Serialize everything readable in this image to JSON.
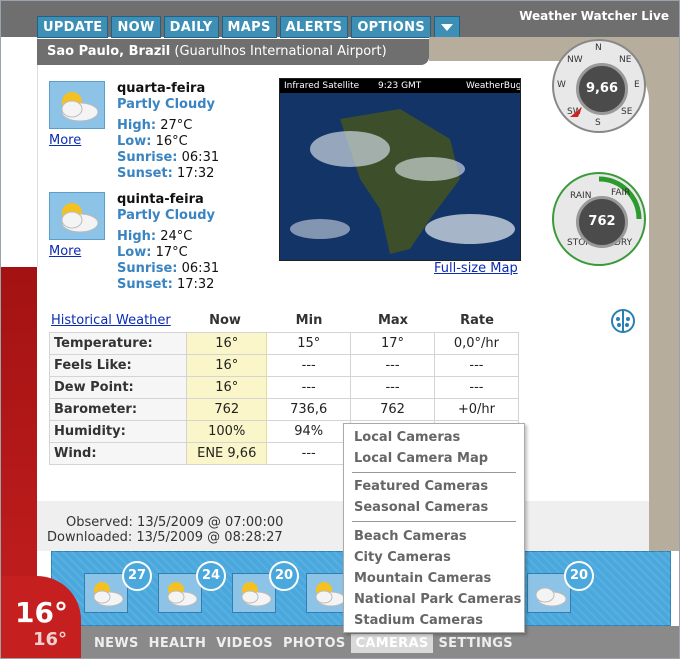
{
  "app": {
    "title": "Weather Watcher Live"
  },
  "menu": [
    "UPDATE",
    "NOW",
    "DAILY",
    "MAPS",
    "ALERTS",
    "OPTIONS"
  ],
  "location": {
    "city": "Sao Paulo, Brazil",
    "station": "(Guarulhos International Airport)"
  },
  "forecast": [
    {
      "day": "quarta-feira",
      "condition": "Partly Cloudy",
      "high_label": "High:",
      "high": "27°C",
      "low_label": "Low:",
      "low": "16°C",
      "sunrise_label": "Sunrise:",
      "sunrise": "06:31",
      "sunset_label": "Sunset:",
      "sunset": "17:32",
      "more": "More"
    },
    {
      "day": "quinta-feira",
      "condition": "Partly Cloudy",
      "high_label": "High:",
      "high": "24°C",
      "low_label": "Low:",
      "low": "17°C",
      "sunrise_label": "Sunrise:",
      "sunrise": "06:31",
      "sunset_label": "Sunset:",
      "sunset": "17:32",
      "more": "More"
    }
  ],
  "satellite": {
    "left": "Infrared Satellite",
    "time": "9:23 GMT",
    "brand": "WeatherBug",
    "link": "Full-size Map"
  },
  "table": {
    "link": "Historical Weather",
    "headers": [
      "Now",
      "Min",
      "Max",
      "Rate"
    ],
    "rows": [
      {
        "label": "Temperature:",
        "now": "16°",
        "min": "15°",
        "max": "17°",
        "rate": "0,0°/hr"
      },
      {
        "label": "Feels Like:",
        "now": "16°",
        "min": "---",
        "max": "---",
        "rate": "---"
      },
      {
        "label": "Dew Point:",
        "now": "16°",
        "min": "---",
        "max": "---",
        "rate": "---"
      },
      {
        "label": "Barometer:",
        "now": "762",
        "min": "736,6",
        "max": "762",
        "rate": "+0/hr"
      },
      {
        "label": "Humidity:",
        "now": "100%",
        "min": "94%",
        "max": "",
        "rate": ""
      },
      {
        "label": "Wind:",
        "now": "ENE 9,66",
        "min": "---",
        "max": "",
        "rate": ""
      }
    ]
  },
  "observed": {
    "observed": "Observed: 13/5/2009 @ 07:00:00",
    "downloaded": "Downloaded: 13/5/2009 @ 08:28:27"
  },
  "current_temp": {
    "main": "16°",
    "secondary": "16°"
  },
  "mini_forecast": [
    "27",
    "24",
    "20",
    "20"
  ],
  "bottom_nav": [
    "NEWS",
    "HEALTH",
    "VIDEOS",
    "PHOTOS",
    "CAMERAS",
    "SETTINGS"
  ],
  "dropdown": {
    "group1": [
      "Local Cameras",
      "Local Camera Map"
    ],
    "group2": [
      "Featured Cameras",
      "Seasonal Cameras"
    ],
    "group3": [
      "Beach Cameras",
      "City Cameras",
      "Mountain Cameras",
      "National Park Cameras",
      "Stadium Cameras"
    ]
  },
  "compass": {
    "value": "9,66",
    "labels": [
      "N",
      "NE",
      "E",
      "SE",
      "S",
      "SW",
      "W",
      "NW"
    ]
  },
  "barometer": {
    "value": "762",
    "labels": [
      "RAIN",
      "FAIR",
      "STORM",
      "DRY"
    ]
  }
}
